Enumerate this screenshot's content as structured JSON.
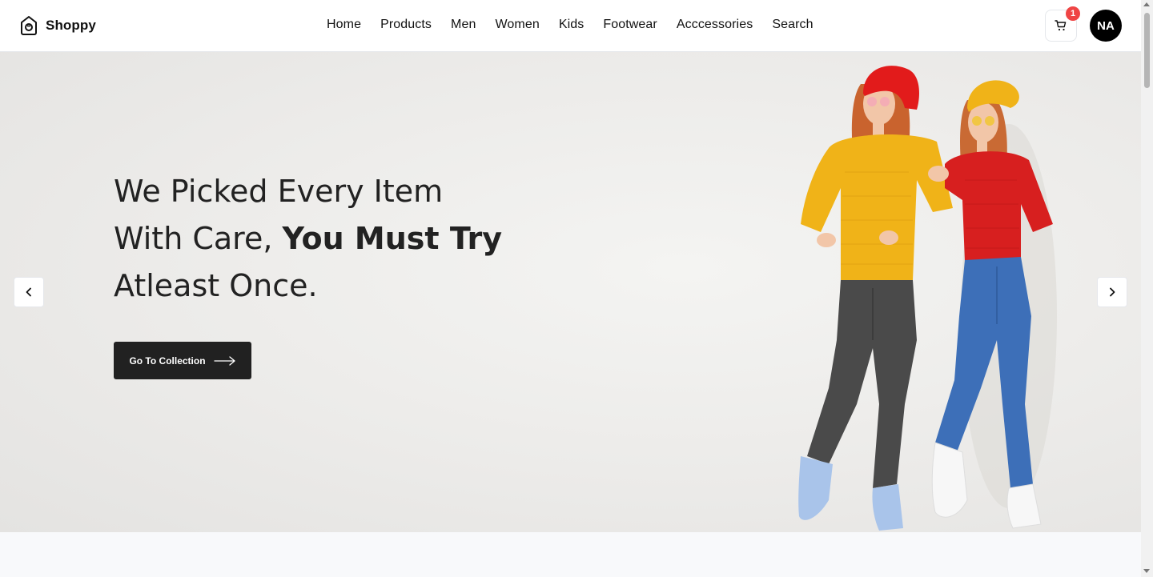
{
  "brand": {
    "name": "Shoppy",
    "icon": "shopping-bag-icon"
  },
  "nav": {
    "items": [
      {
        "label": "Home"
      },
      {
        "label": "Products"
      },
      {
        "label": "Men"
      },
      {
        "label": "Women"
      },
      {
        "label": "Kids"
      },
      {
        "label": "Footwear"
      },
      {
        "label": "Acccessories"
      },
      {
        "label": "Search"
      }
    ]
  },
  "cart": {
    "icon": "cart-icon",
    "count": "1"
  },
  "user": {
    "initials": "NA"
  },
  "hero": {
    "line1": "We Picked Every Item",
    "line2_regular": "With Care, ",
    "line2_bold": "You Must Try",
    "line3": "Atleast Once.",
    "cta_label": "Go To Collection",
    "cta_icon": "long-arrow-right-icon",
    "prev_icon": "chevron-left-icon",
    "next_icon": "chevron-right-icon",
    "image": "two-women-in-sweaters-and-jeans-photo"
  },
  "colors": {
    "cta_background": "#212121",
    "badge": "#ef4444",
    "avatar": "#000000",
    "hero_background": "#ecebe9"
  }
}
